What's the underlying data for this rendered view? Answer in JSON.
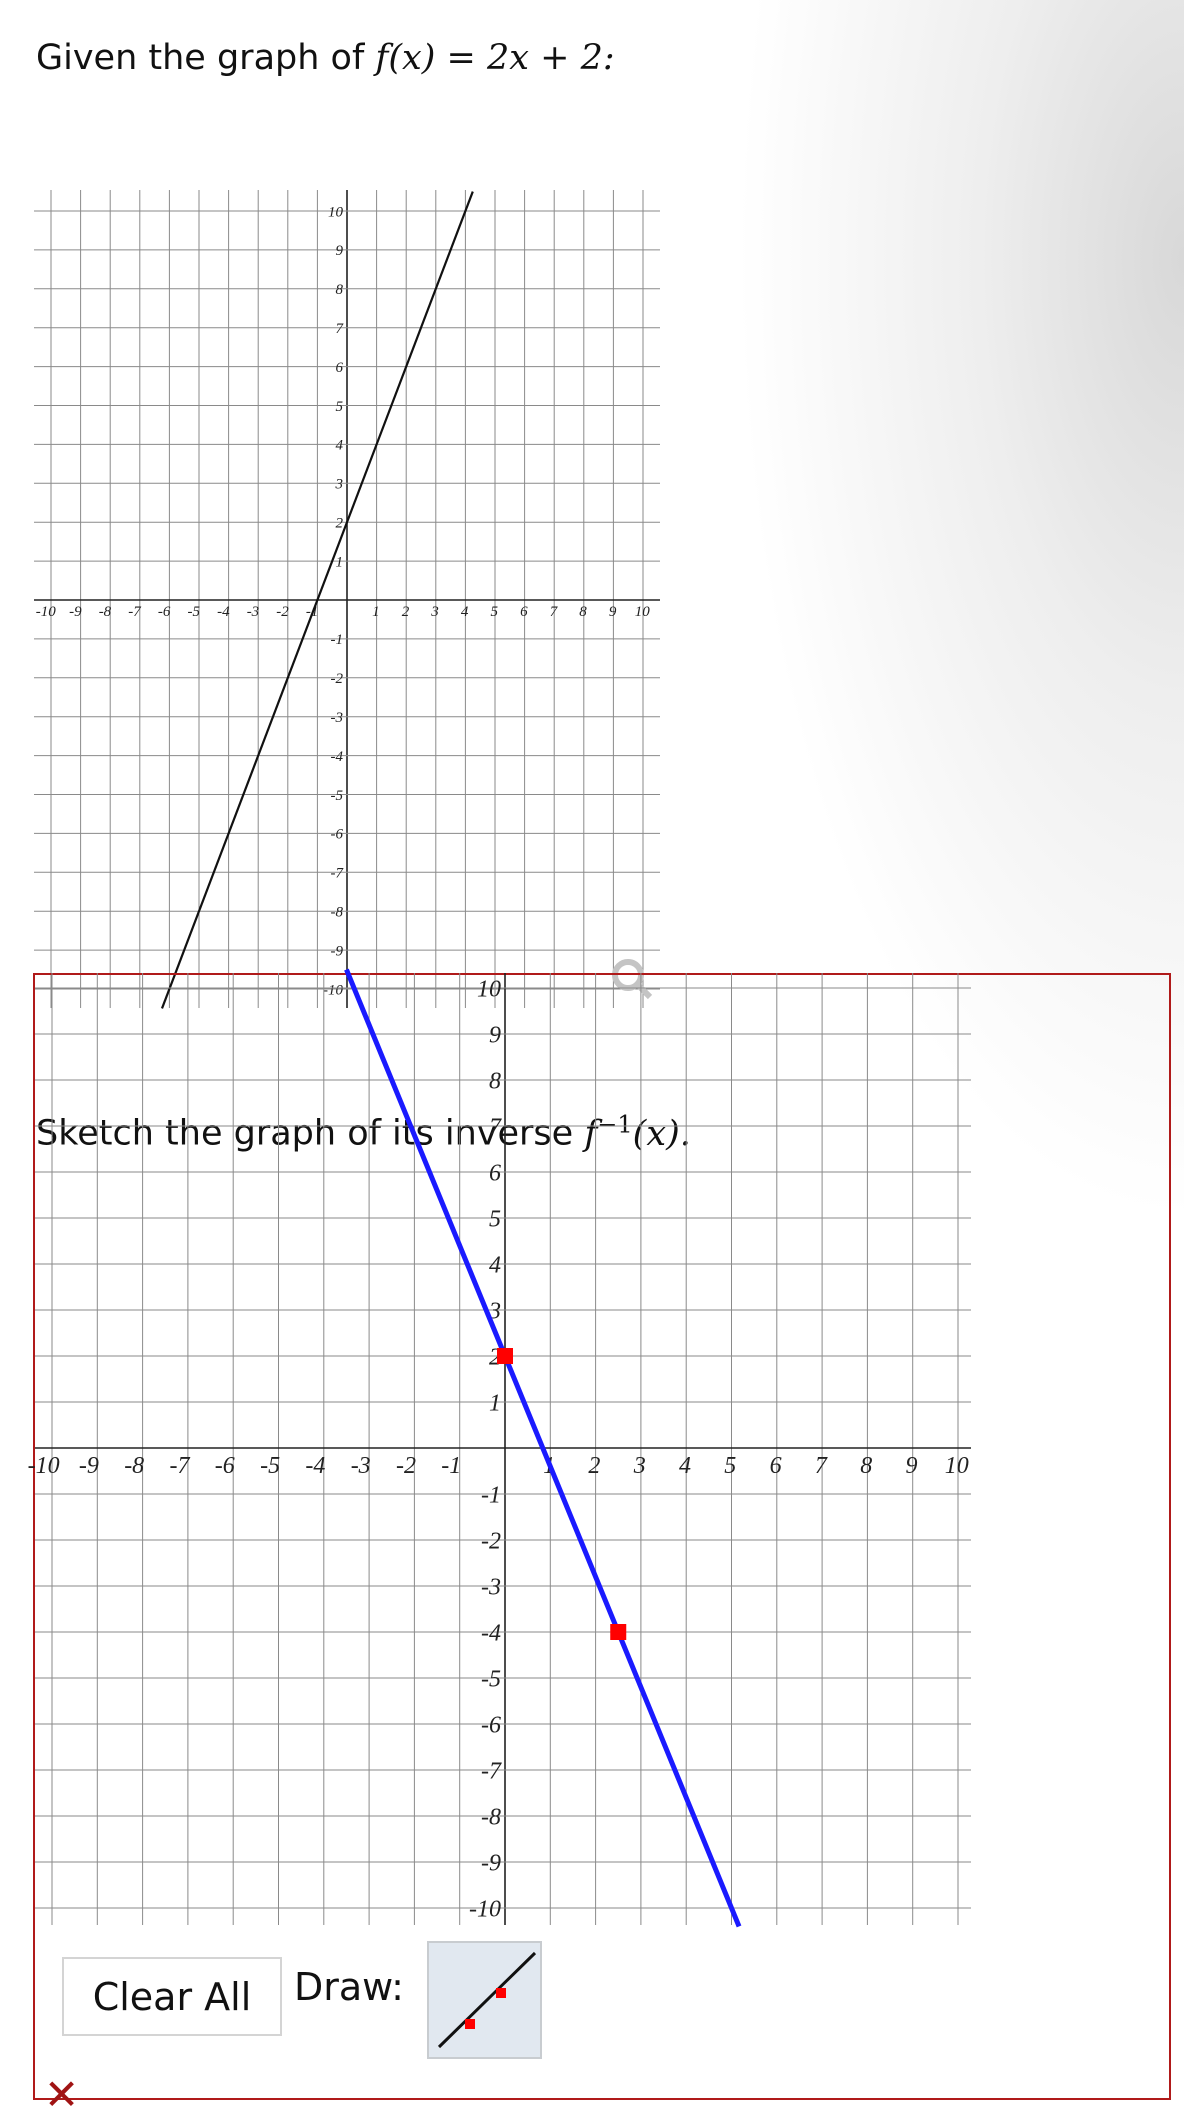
{
  "question": {
    "given_text": "Given the graph of",
    "function_expr": "f(x) = 2x + 2:",
    "sketch_text": "Sketch the graph of its inverse",
    "inverse_expr": "f",
    "inverse_sup": "−1",
    "inverse_arg": "(x)."
  },
  "controls": {
    "clear_label": "Clear All",
    "draw_label": "Draw:",
    "draw_tool_icon": "line-segment-tool-icon",
    "status_icon": "incorrect-x-icon",
    "status_symbol": "✕",
    "status_color": "#a01414"
  },
  "chart_data": [
    {
      "type": "line",
      "xlim": [
        -10,
        10
      ],
      "ylim": [
        -10,
        10
      ],
      "grid": true,
      "x_ticks": [
        -10,
        -9,
        -8,
        -7,
        -6,
        -5,
        -4,
        -3,
        -2,
        -1,
        1,
        2,
        3,
        4,
        5,
        6,
        7,
        8,
        9,
        10
      ],
      "y_ticks": [
        10,
        9,
        8,
        7,
        6,
        5,
        4,
        3,
        2,
        1,
        -1,
        -2,
        -3,
        -4,
        -5,
        -6,
        -7,
        -8,
        -9,
        -10
      ],
      "series": [
        {
          "slope": 2,
          "intercept": 2,
          "color": "#111111"
        }
      ],
      "zoom_icon": "magnifier-icon"
    },
    {
      "type": "line",
      "xlim": [
        -10,
        10
      ],
      "ylim": [
        -10,
        10
      ],
      "grid": true,
      "x_ticks": [
        -10,
        -9,
        -8,
        -7,
        -6,
        -5,
        -4,
        -3,
        -2,
        -1,
        1,
        2,
        3,
        4,
        5,
        6,
        7,
        8,
        9,
        10
      ],
      "y_ticks": [
        10,
        9,
        8,
        7,
        6,
        5,
        4,
        3,
        2,
        1,
        -1,
        -2,
        -3,
        -4,
        -5,
        -6,
        -7,
        -8,
        -9,
        -10
      ],
      "series": [
        {
          "points": [
            [
              0,
              2
            ],
            [
              2.5,
              -4
            ]
          ],
          "color": "#1a1aff",
          "point_color": "#ff0000"
        }
      ]
    }
  ]
}
